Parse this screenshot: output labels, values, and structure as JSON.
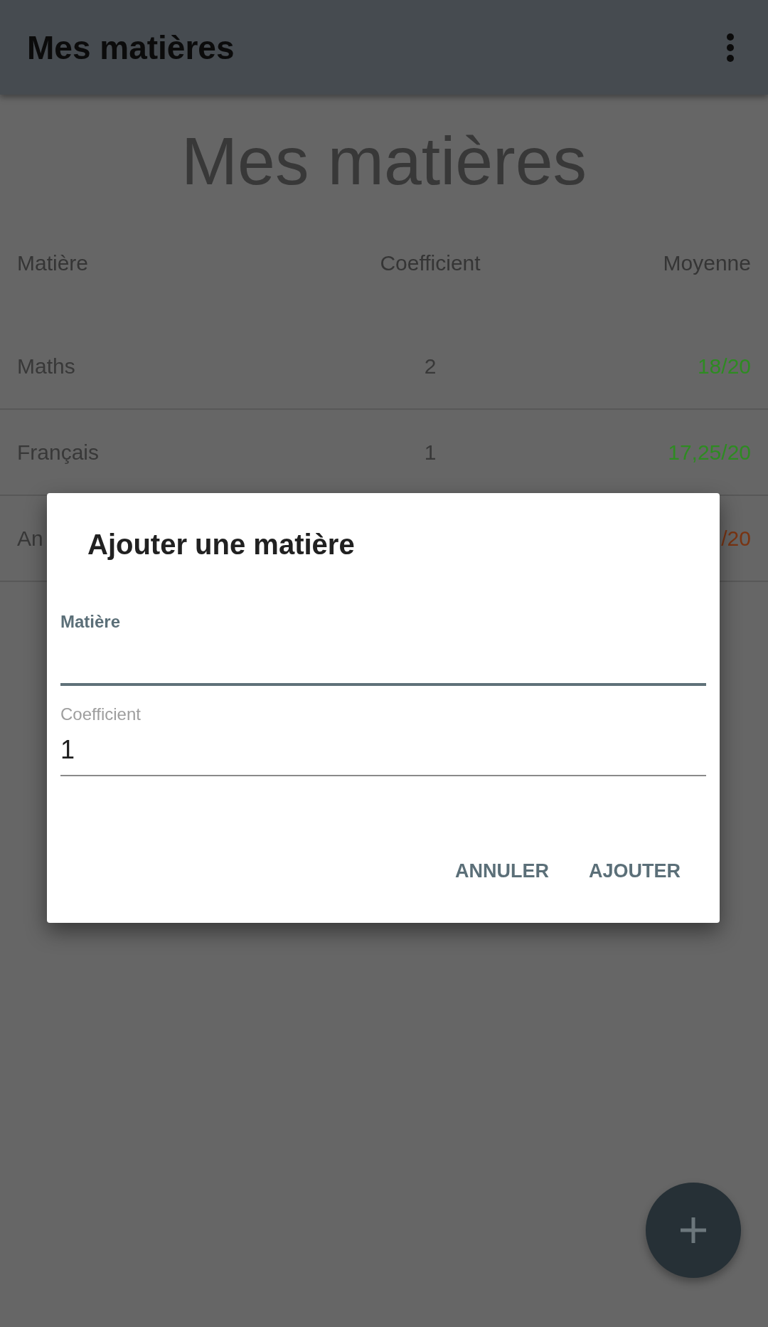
{
  "app_bar": {
    "title": "Mes matières"
  },
  "page_title": "Mes matières",
  "table": {
    "columns": [
      "Matière",
      "Coefficient",
      "Moyenne"
    ],
    "rows": [
      {
        "subject": "Maths",
        "coefficient": "2",
        "average": "18/20",
        "color": "#2e8b22"
      },
      {
        "subject": "Français",
        "coefficient": "1",
        "average": "17,25/20",
        "color": "#2e8b22"
      },
      {
        "subject": "An",
        "average": "/20",
        "color": "#7a3412"
      }
    ]
  },
  "dialog": {
    "title": "Ajouter une matière",
    "fields": [
      {
        "label": "Matière",
        "focused": true
      },
      {
        "label": "Coefficient",
        "value": "1",
        "focused": false
      }
    ],
    "buttons": [
      "ANNULER",
      "AJOUTER"
    ]
  }
}
